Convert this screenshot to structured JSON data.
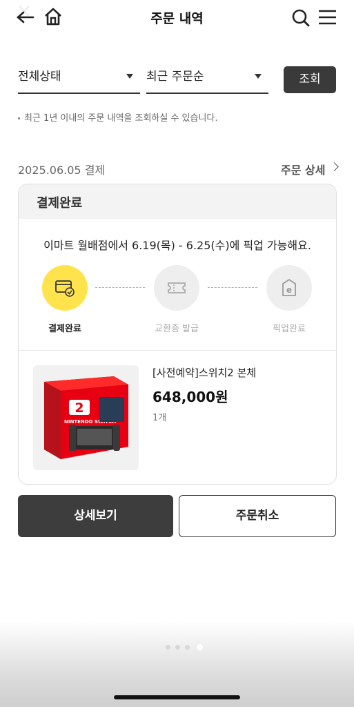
{
  "header": {
    "title": "주문 내역",
    "back_icon": "back-arrow-icon",
    "home_icon": "home-icon",
    "search_icon": "search-icon",
    "menu_icon": "menu-icon"
  },
  "filters": {
    "status_select": "전체상태",
    "sort_select": "최근 주문순",
    "search_button": "조회",
    "notice": "최근 1년 이내의 주문 내역을 조회하실 수 있습니다."
  },
  "order": {
    "date": "2025.06.05 결제",
    "detail_link": "주문 상세",
    "status": "결제완료",
    "pickup_message": "이마트 월배점에서 6.19(목) - 6.25(수)에 픽업 가능해요.",
    "steps": [
      {
        "label": "결제완료",
        "icon": "card-check-icon",
        "active": true
      },
      {
        "label": "교환증 발급",
        "icon": "ticket-icon",
        "active": false
      },
      {
        "label": "픽업완료",
        "icon": "emart-bag-icon",
        "active": false
      }
    ],
    "product": {
      "name": "[사전예약]스위치2 본체",
      "price": "648,000원",
      "quantity": "1개",
      "box_text": "NINTENDO SWITCH",
      "box_number": "2"
    }
  },
  "actions": {
    "detail_button": "상세보기",
    "cancel_button": "주문취소"
  },
  "colors": {
    "accent_yellow": "#ffe34d",
    "dark_button": "#3d3d3d",
    "switch_red": "#e60012"
  },
  "pagination": {
    "count": 4,
    "active_index": 3
  }
}
